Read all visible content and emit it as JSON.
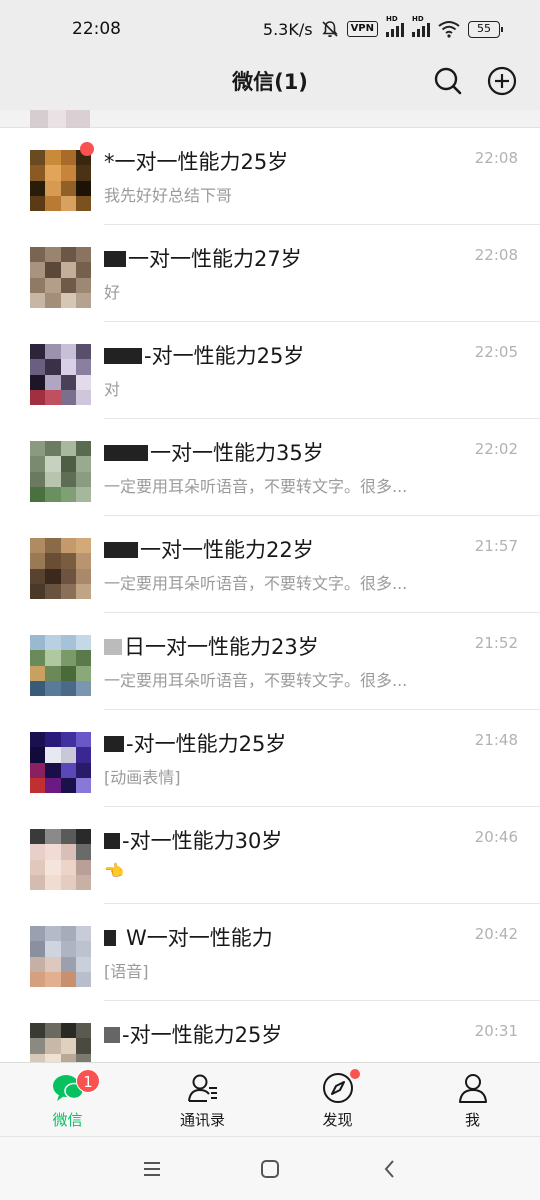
{
  "status_bar": {
    "time": "22:08",
    "speed": "5.3K/s",
    "vpn": "VPN",
    "hd1": "HD",
    "hd2": "HD",
    "battery": "55"
  },
  "header": {
    "title": "微信(1)",
    "icons": [
      "search-icon",
      "add-icon"
    ]
  },
  "chats": [
    {
      "name_prefix": "*",
      "name": "一对一性能力25岁",
      "preview": "我先好好总结下哥",
      "time": "22:08",
      "unread_dot": true
    },
    {
      "name_prefix": "",
      "name": "一对一性能力27岁",
      "preview": "好",
      "time": "22:08",
      "unread_dot": false
    },
    {
      "name_prefix": "",
      "name": "-对一性能力25岁",
      "preview": "对",
      "time": "22:05",
      "unread_dot": false
    },
    {
      "name_prefix": "",
      "name": "一对一性能力35岁",
      "preview": "一定要用耳朵听语音，不要转文字。很多...",
      "time": "22:02",
      "unread_dot": false
    },
    {
      "name_prefix": "",
      "name": "一对一性能力22岁",
      "preview": "一定要用耳朵听语音，不要转文字。很多...",
      "time": "21:57",
      "unread_dot": false
    },
    {
      "name_prefix": "",
      "name": "日一对一性能力23岁",
      "preview": "一定要用耳朵听语音，不要转文字。很多...",
      "time": "21:52",
      "unread_dot": false
    },
    {
      "name_prefix": "",
      "name": "-对一性能力25岁",
      "preview": "[动画表情]",
      "time": "21:48",
      "unread_dot": false
    },
    {
      "name_prefix": "",
      "name": "-对一性能力30岁",
      "preview": "👈",
      "time": "20:46",
      "unread_dot": false
    },
    {
      "name_prefix": "",
      "name": "W一对一性能力",
      "preview": "[语音]",
      "time": "20:42",
      "unread_dot": false
    },
    {
      "name_prefix": "",
      "name": "-对一性能力25岁",
      "preview": "",
      "time": "20:31",
      "unread_dot": false
    }
  ],
  "bottom_nav": [
    {
      "label": "微信",
      "icon": "chat-icon",
      "badge": "1",
      "active": true
    },
    {
      "label": "通讯录",
      "icon": "contacts-icon",
      "badge": "",
      "active": false
    },
    {
      "label": "发现",
      "icon": "discover-icon",
      "badge": "",
      "active": false
    },
    {
      "label": "我",
      "icon": "me-icon",
      "badge": "",
      "active": false
    }
  ],
  "colors": {
    "accent": "#07c160",
    "badge": "#fa5151",
    "header_bg": "#ededed",
    "time_text": "#b2b2b2",
    "preview_text": "#9b9b9b"
  }
}
